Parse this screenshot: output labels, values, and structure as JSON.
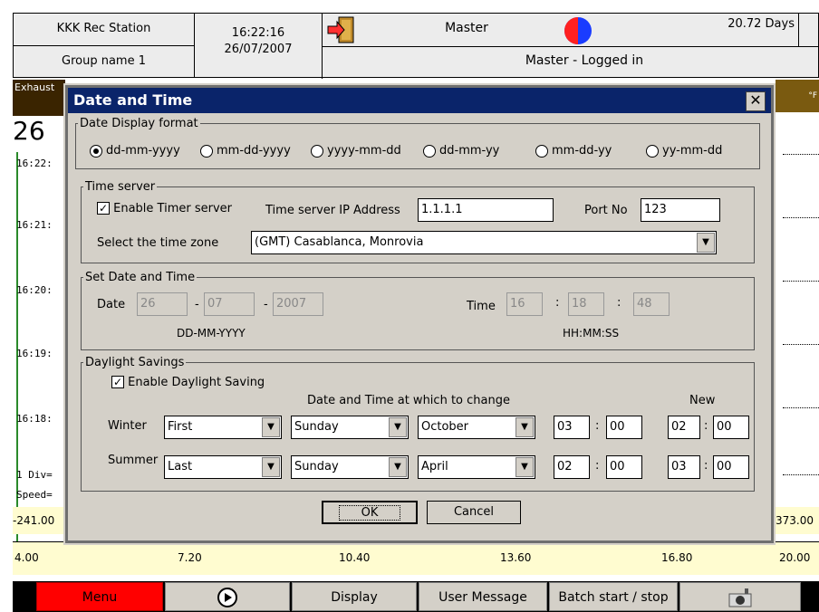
{
  "header": {
    "station": "KKK Rec Station",
    "group": "Group name 1",
    "time": "16:22:16",
    "date": "26/07/2007",
    "user": "Master",
    "login_status": "Master - Logged in",
    "days": "20.72 Days"
  },
  "background": {
    "channel_label": "Exhaust",
    "value_partial": "26",
    "timestamps": [
      "16:22:",
      "16:21:",
      "16:20:",
      "16:19:",
      "16:18:"
    ],
    "div_text": "1 Div=",
    "speed_text": "Speed=",
    "left_value": "-241.00",
    "right_value": "373.00",
    "unit": "°F",
    "axis_ticks": [
      "4.00",
      "7.20",
      "10.40",
      "13.60",
      "16.80",
      "20.00"
    ]
  },
  "buttons": {
    "menu": "Menu",
    "display": "Display",
    "user_message": "User Message",
    "batch": "Batch start / stop"
  },
  "dialog": {
    "title": "Date and Time",
    "date_format": {
      "legend": "Date Display format",
      "options": [
        "dd-mm-yyyy",
        "mm-dd-yyyy",
        "yyyy-mm-dd",
        "dd-mm-yy",
        "mm-dd-yy",
        "yy-mm-dd"
      ],
      "selected": "dd-mm-yyyy"
    },
    "time_server": {
      "legend": "Time server",
      "enable_label": "Enable Timer server",
      "enabled": true,
      "ip_label": "Time server IP Address",
      "ip_value": "1.1.1.1",
      "port_label": "Port No",
      "port_value": "123",
      "zone_label": "Select the time zone",
      "zone_value": "(GMT) Casablanca, Monrovia"
    },
    "set_date_time": {
      "legend": "Set Date and Time",
      "date_label": "Date",
      "day": "26",
      "month": "07",
      "year": "2007",
      "date_sep": "-",
      "date_hint": "DD-MM-YYYY",
      "time_label": "Time",
      "hour": "16",
      "minute": "18",
      "second": "48",
      "time_sep": ":",
      "time_hint": "HH:MM:SS"
    },
    "daylight": {
      "legend": "Daylight Savings",
      "enable_label": "Enable Daylight Saving",
      "enabled": true,
      "change_header": "Date and Time at which to change",
      "new_header": "New",
      "winter": {
        "label": "Winter",
        "week": "First",
        "day": "Sunday",
        "month": "October",
        "hh": "03",
        "mm": "00",
        "new_hh": "02",
        "new_mm": "00"
      },
      "summer": {
        "label": "Summer",
        "week": "Last",
        "day": "Sunday",
        "month": "April",
        "hh": "02",
        "mm": "00",
        "new_hh": "03",
        "new_mm": "00"
      }
    },
    "ok_label": "OK",
    "cancel_label": "Cancel"
  },
  "colors": {
    "title_bar": "#0a246a",
    "menu_button": "#ff0000",
    "axis_bg": "#fffcd0",
    "dialog_face": "#d4d0c8"
  }
}
